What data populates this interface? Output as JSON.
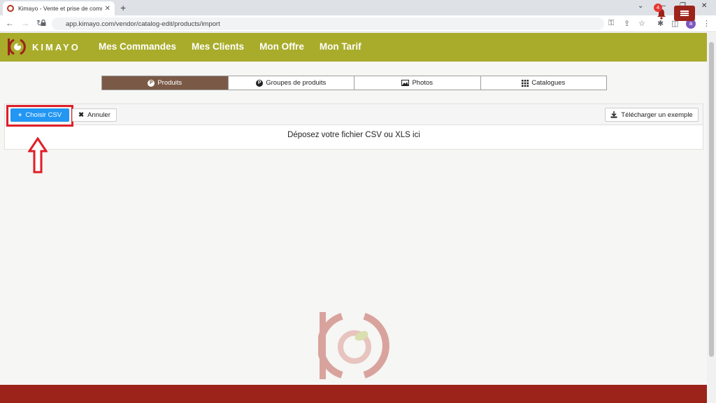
{
  "browser": {
    "tab_title": "Kimayo - Vente et prise de comm",
    "tab_close": "✕",
    "new_tab": "+",
    "url": "app.kimayo.com/vendor/catalog-edit/products/import",
    "profile_initial": "a",
    "window_controls": [
      "⌄",
      "—",
      "❐",
      "✕"
    ]
  },
  "header": {
    "brand": "KIMAYO",
    "nav": [
      "Mes Commandes",
      "Mes Clients",
      "Mon Offre",
      "Mon Tarif"
    ],
    "notification_count": "4",
    "accent_color": "#a9ac2a",
    "brand_color": "#9c231a"
  },
  "subtabs": [
    {
      "label": "Produits",
      "icon": "p-circle-icon",
      "active": true
    },
    {
      "label": "Groupes de produits",
      "icon": "p-circle-icon",
      "active": false
    },
    {
      "label": "Photos",
      "icon": "image-icon",
      "active": false
    },
    {
      "label": "Catalogues",
      "icon": "grid-icon",
      "active": false
    }
  ],
  "upload": {
    "choose_label": "Choisir CSV",
    "cancel_label": "Annuler",
    "download_label": "Télécharger un exemple",
    "dropzone_text": "Déposez votre fichier CSV ou XLS ici"
  }
}
